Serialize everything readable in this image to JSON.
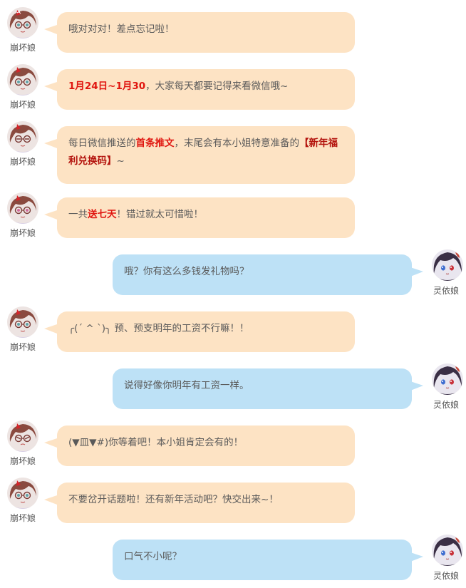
{
  "characters": {
    "left_name": "崩坏娘",
    "right_name": "灵依娘"
  },
  "colors": {
    "left_bubble": "#fde3c4",
    "right_bubble": "#bde1f6",
    "highlight_red": "#e0150f",
    "highlight_dark_red": "#b3120c"
  },
  "messages": [
    {
      "side": "left",
      "parts": [
        {
          "t": "哦对对对！差点忘记啦！"
        }
      ]
    },
    {
      "side": "left",
      "parts": [
        {
          "t": "1月24日~1月30",
          "s": "red"
        },
        {
          "t": "，大家每天都要记得来看微信哦~"
        }
      ]
    },
    {
      "side": "left",
      "parts": [
        {
          "t": "每日微信推送的"
        },
        {
          "t": "首条推文",
          "s": "red"
        },
        {
          "t": "，末尾会有本小姐特意准备的"
        },
        {
          "t": "【新年福利兑换码】",
          "s": "dark"
        },
        {
          "t": "~"
        }
      ]
    },
    {
      "side": "left",
      "parts": [
        {
          "t": "一共"
        },
        {
          "t": "送七天",
          "s": "red"
        },
        {
          "t": "！错过就太可惜啦！"
        }
      ]
    },
    {
      "side": "right",
      "parts": [
        {
          "t": "哦？你有这么多钱发礼物吗？"
        }
      ]
    },
    {
      "side": "left",
      "parts": [
        {
          "t": "╭(´ ^ `)╮ 预、预支明年的工资不行嘛！！"
        }
      ]
    },
    {
      "side": "right",
      "parts": [
        {
          "t": "说得好像你明年有工资一样。"
        }
      ]
    },
    {
      "side": "left",
      "parts": [
        {
          "t": "(▼皿▼#)你等着吧！本小姐肯定会有的！"
        }
      ]
    },
    {
      "side": "left",
      "parts": [
        {
          "t": "不要岔开话题啦！还有新年活动吧？快交出来~！"
        }
      ]
    },
    {
      "side": "right",
      "parts": [
        {
          "t": "口气不小呢？"
        }
      ]
    }
  ]
}
